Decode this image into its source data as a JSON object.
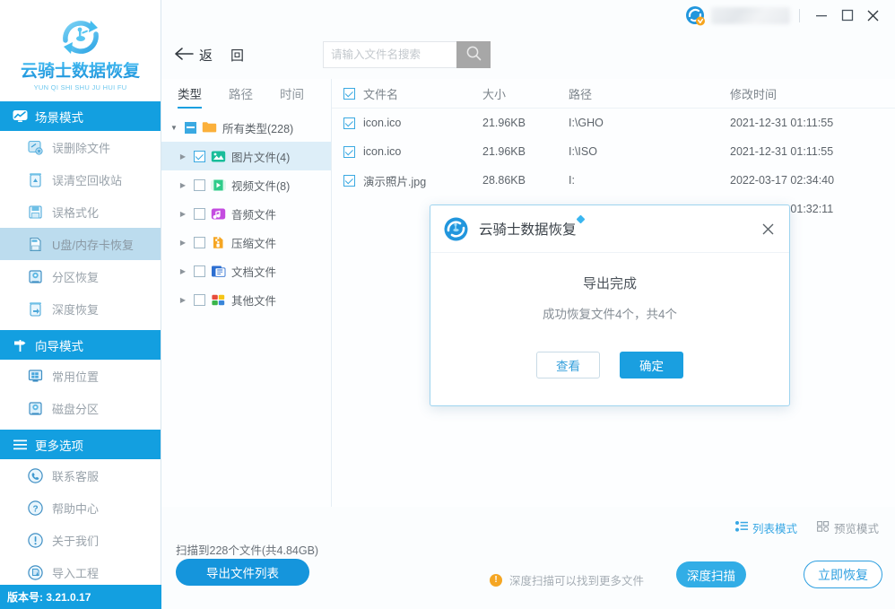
{
  "colors": {
    "accent": "#139FE0",
    "accent_light": "#32ADE6",
    "sidebar_selected": "#BCDCEE",
    "tree_selected": "#DDEEF8",
    "warning": "#F5A623"
  },
  "sidebar": {
    "logo": {
      "title": "云骑士数据恢复",
      "subtitle": "YUN QI SHI SHU JU HUI FU",
      "icon": "recovery-cycle-logo"
    },
    "sections": [
      {
        "id": "scene-mode",
        "icon": "scene-mode-icon",
        "label": "场景模式",
        "items": [
          {
            "id": "deleted-files",
            "icon": "deleted-file-icon",
            "label": "误删除文件",
            "active": false
          },
          {
            "id": "empty-recycle",
            "icon": "recycle-bin-icon",
            "label": "误清空回收站",
            "active": false
          },
          {
            "id": "format",
            "icon": "format-disk-icon",
            "label": "误格式化",
            "active": false
          },
          {
            "id": "usb-sdcard",
            "icon": "usb-card-icon",
            "label": "U盘/内存卡恢复",
            "active": true
          },
          {
            "id": "partition",
            "icon": "partition-icon",
            "label": "分区恢复",
            "active": false
          },
          {
            "id": "deep-recover",
            "icon": "deep-recover-icon",
            "label": "深度恢复",
            "active": false
          }
        ]
      },
      {
        "id": "wizard-mode",
        "icon": "signpost-icon",
        "label": "向导模式",
        "items": [
          {
            "id": "common-locations",
            "icon": "windows-icon",
            "label": "常用位置",
            "active": false
          },
          {
            "id": "disk-partition",
            "icon": "harddisk-icon",
            "label": "磁盘分区",
            "active": false
          }
        ]
      },
      {
        "id": "more-options",
        "icon": "hamburger-icon",
        "label": "更多选项",
        "items": [
          {
            "id": "contact-support",
            "icon": "phone-icon",
            "label": "联系客服",
            "active": false
          },
          {
            "id": "help-center",
            "icon": "question-icon",
            "label": "帮助中心",
            "active": false
          },
          {
            "id": "about-us",
            "icon": "exclamation-icon",
            "label": "关于我们",
            "active": false
          },
          {
            "id": "import-project",
            "icon": "import-icon",
            "label": "导入工程",
            "active": false
          }
        ]
      }
    ],
    "version": "版本号: 3.21.0.17"
  },
  "titlebar": {
    "avatar_icon": "user-avatar-icon",
    "username": "",
    "minimize": "—",
    "maximize": "▢",
    "close": "✕"
  },
  "toolbar": {
    "back_label": "返",
    "back_label2": "回",
    "back_icon": "arrow-left-icon"
  },
  "search": {
    "placeholder": "请输入文件名搜索",
    "value": "",
    "icon": "search-icon"
  },
  "tree": {
    "tabs": [
      {
        "id": "type",
        "label": "类型",
        "active": true
      },
      {
        "id": "path",
        "label": "路径",
        "active": false
      },
      {
        "id": "time",
        "label": "时间",
        "active": false
      }
    ],
    "rows": [
      {
        "id": "all-types",
        "label": "所有类型(228)",
        "icon": "folder-icon",
        "checkbox": "partial",
        "twisty": "open",
        "level": 0,
        "selected": false
      },
      {
        "id": "images",
        "label": "图片文件(4)",
        "icon": "image-icon",
        "checkbox": "checked",
        "twisty": "collapsed",
        "level": 1,
        "selected": true
      },
      {
        "id": "videos",
        "label": "视频文件(8)",
        "icon": "video-icon",
        "checkbox": "unchecked",
        "twisty": "collapsed",
        "level": 1,
        "selected": false
      },
      {
        "id": "audio",
        "label": "音频文件",
        "icon": "audio-icon",
        "checkbox": "unchecked",
        "twisty": "collapsed",
        "level": 1,
        "selected": false
      },
      {
        "id": "archives",
        "label": "压缩文件",
        "icon": "archive-icon",
        "checkbox": "unchecked",
        "twisty": "collapsed",
        "level": 1,
        "selected": false
      },
      {
        "id": "documents",
        "label": "文档文件",
        "icon": "document-icon",
        "checkbox": "unchecked",
        "twisty": "collapsed",
        "level": 1,
        "selected": false
      },
      {
        "id": "others",
        "label": "其他文件",
        "icon": "other-icon",
        "checkbox": "unchecked",
        "twisty": "collapsed",
        "level": 1,
        "selected": false
      }
    ]
  },
  "filelist": {
    "headers": {
      "name": "文件名",
      "size": "大小",
      "path": "路径",
      "time": "修改时间"
    },
    "header_checkbox": "checked",
    "rows": [
      {
        "checked": true,
        "name": "icon.ico",
        "size": "21.96KB",
        "path": "I:\\GHO",
        "time": "2021-12-31 01:11:55"
      },
      {
        "checked": true,
        "name": "icon.ico",
        "size": "21.96KB",
        "path": "I:\\ISO",
        "time": "2021-12-31 01:11:55"
      },
      {
        "checked": true,
        "name": "演示照片.jpg",
        "size": "28.86KB",
        "path": "I:",
        "time": "2022-03-17 02:34:40"
      },
      {
        "checked": true,
        "name": "",
        "size": "",
        "path": "",
        "time": "2022-03-01 01:32:11"
      }
    ]
  },
  "bottom": {
    "list_mode": "列表模式",
    "preview_mode": "预览模式",
    "list_mode_icon": "list-view-icon",
    "preview_mode_icon": "grid-view-icon",
    "scan_summary": "扫描到228个文件(共4.84GB)",
    "export_label": "导出文件列表",
    "hint": "深度扫描可以找到更多文件",
    "hint_icon": "warning-icon",
    "deep_scan_label": "深度扫描",
    "recover_label": "立即恢复"
  },
  "dialog": {
    "title": "云骑士数据恢复",
    "logo_icon": "recovery-cycle-logo",
    "close_icon": "close-icon",
    "message": "导出完成",
    "detail": "成功恢复文件4个，共4个",
    "view_label": "查看",
    "confirm_label": "确定"
  }
}
